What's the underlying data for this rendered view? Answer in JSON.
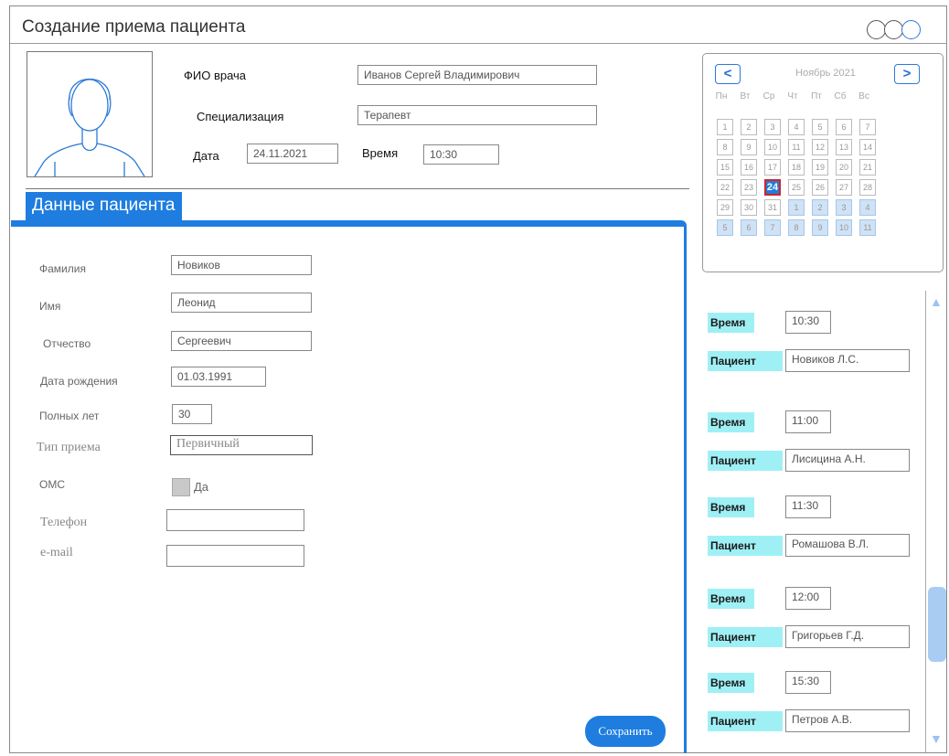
{
  "window": {
    "title": "Создание приема пациента"
  },
  "doctor": {
    "name_label": "ФИО врача",
    "name_value": "Иванов Сергей Владимирович",
    "spec_label": "Специализация",
    "spec_value": "Терапевт",
    "date_label": "Дата",
    "date_value": "24.11.2021",
    "time_label": "Время",
    "time_value": "10:30"
  },
  "patient": {
    "tab_label": "Данные пациента",
    "fields": [
      {
        "label": "Фамилия",
        "value": "Новиков"
      },
      {
        "label": "Имя",
        "value": "Леонид"
      },
      {
        "label": "Отчество",
        "value": "Сергеевич"
      },
      {
        "label": "Дата рождения",
        "value": "01.03.1991"
      },
      {
        "label": "Полных лет",
        "value": "30"
      },
      {
        "label": "Тип приема",
        "value": "Первичный"
      },
      {
        "label": "ОМС",
        "value": "Да"
      },
      {
        "label": "Телефон",
        "value": ""
      },
      {
        "label": "e-mail",
        "value": ""
      }
    ],
    "save_label": "Сохранить"
  },
  "calendar": {
    "prev": "<",
    "next": ">",
    "month": "Ноябрь 2021",
    "weekdays": [
      "Пн",
      "Вт",
      "Ср",
      "Чт",
      "Пт",
      "Сб",
      "Вс"
    ],
    "weeks": [
      [
        "1",
        "2",
        "3",
        "4",
        "5",
        "6",
        "7"
      ],
      [
        "8",
        "9",
        "10",
        "11",
        "12",
        "13",
        "14"
      ],
      [
        "15",
        "16",
        "17",
        "18",
        "19",
        "20",
        "21"
      ],
      [
        "22",
        "23",
        "24",
        "25",
        "26",
        "27",
        "28"
      ],
      [
        "29",
        "30",
        "31",
        "1",
        "2",
        "3",
        "4"
      ],
      [
        "5",
        "6",
        "7",
        "8",
        "9",
        "10",
        "11"
      ]
    ],
    "selected": "24"
  },
  "schedule": {
    "time_label": "Время",
    "patient_label": "Пациент",
    "items": [
      {
        "time": "10:30",
        "patient": "Новиков Л.С."
      },
      {
        "time": "11:00",
        "patient": "Лисицина А.Н."
      },
      {
        "time": "11:30",
        "patient": "Ромашова В.Л."
      },
      {
        "time": "12:00",
        "patient": "Григорьев Г.Д."
      },
      {
        "time": "15:30",
        "patient": "Петров А.В."
      }
    ]
  },
  "colors": {
    "accent": "#1e7ddf",
    "label_bg": "#9ff0f5",
    "selected_border": "#d32424"
  },
  "icons": {
    "scroll_up": "▲",
    "scroll_down": "▼"
  }
}
